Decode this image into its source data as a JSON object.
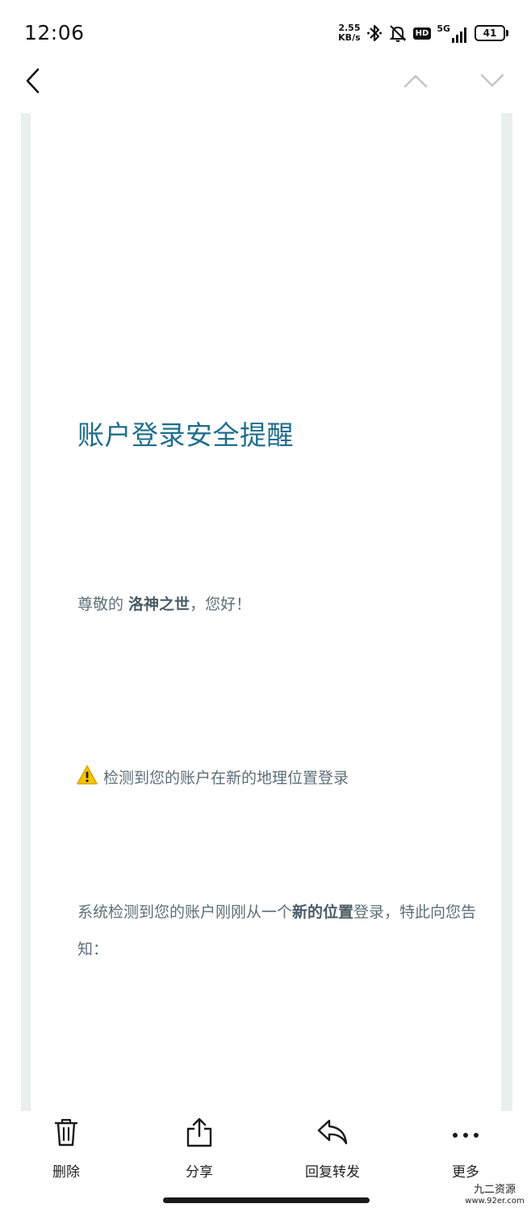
{
  "status_bar": {
    "time": "12:06",
    "net_speed_value": "2.55",
    "net_speed_unit": "KB/s",
    "hd_label": "HD",
    "network_label": "5G",
    "battery_level": "41"
  },
  "nav": {
    "back_icon": "chevron-left-icon",
    "prev_icon": "chevron-up-icon",
    "next_icon": "chevron-down-icon"
  },
  "email": {
    "title": "账户登录安全提醒",
    "greeting_prefix": "尊敬的 ",
    "username": "洛神之世",
    "greeting_suffix": "，您好！",
    "alert_icon": "warning-icon",
    "alert_text": "检测到您的账户在新的地理位置登录",
    "body_part1": "系统检测到您的账户刚刚从一个",
    "body_highlight": "新的位置",
    "body_part2": "登录，特此向您告知："
  },
  "toolbar": {
    "delete_label": "删除",
    "share_label": "分享",
    "reply_forward_label": "回复转发",
    "more_label": "更多"
  },
  "watermark": {
    "name": "九二资源",
    "url": "www.92er.com"
  },
  "colors": {
    "title": "#1f6e8c",
    "body_text": "#5e6f78",
    "frame": "#e9eef0"
  }
}
